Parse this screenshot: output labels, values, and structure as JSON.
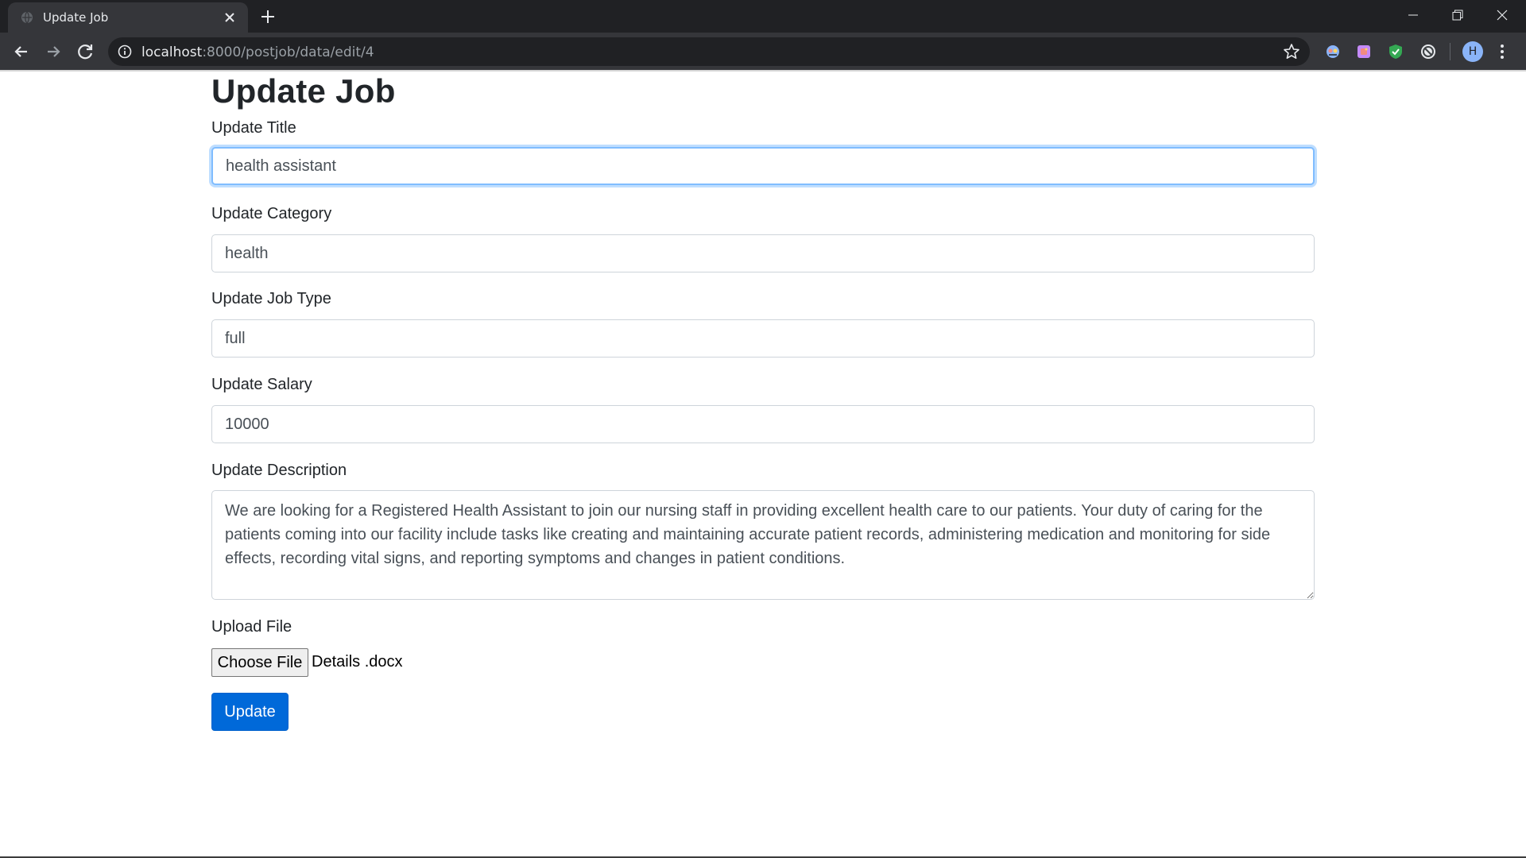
{
  "browser": {
    "tab_title": "Update Job",
    "url_host": "localhost",
    "url_path": ":8000/postjob/data/edit/4",
    "avatar_letter": "H"
  },
  "page": {
    "heading": "Update Job",
    "fields": {
      "title": {
        "label": "Update Title",
        "value": "health assistant"
      },
      "category": {
        "label": "Update Category",
        "value": "health"
      },
      "job_type": {
        "label": "Update Job Type",
        "value": "full"
      },
      "salary": {
        "label": "Update Salary",
        "value": "10000"
      },
      "description": {
        "label": "Update Description",
        "value": "We are looking for a Registered Health Assistant to join our nursing staff in providing excellent health care to our patients. Your duty of caring for the patients coming into our facility include tasks like creating and maintaining accurate patient records, administering medication and monitoring for side effects, recording vital signs, and reporting symptoms and changes in patient conditions."
      }
    },
    "upload": {
      "label": "Upload File",
      "button_label": "Choose File",
      "file_name": "Details .docx"
    },
    "submit_label": "Update"
  },
  "colors": {
    "primary_button": "#0069d9",
    "focus_border": "#80bdff",
    "chrome_dark": "#202124",
    "chrome_toolbar": "#35363a"
  },
  "icons": [
    "globe-icon",
    "close-icon",
    "plus-icon",
    "minimize-icon",
    "restore-icon",
    "back-arrow-icon",
    "forward-arrow-icon",
    "reload-icon",
    "info-icon",
    "star-icon",
    "extension-icon",
    "kebab-menu-icon"
  ]
}
